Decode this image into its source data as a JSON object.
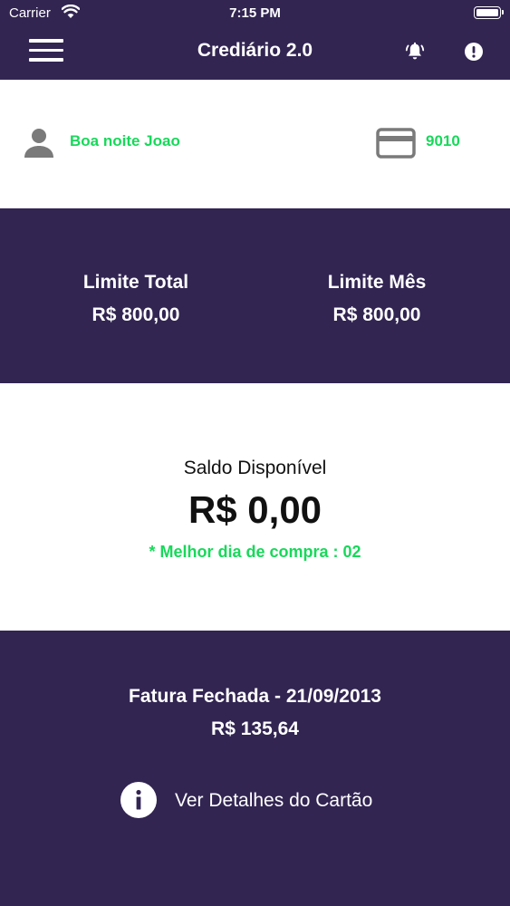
{
  "status_bar": {
    "carrier": "Carrier",
    "time": "7:15 PM"
  },
  "header": {
    "title": "Crediário 2.0"
  },
  "user": {
    "greeting": "Boa noite Joao",
    "card_number": "9010"
  },
  "limits": {
    "total_label": "Limite Total",
    "total_value": "R$ 800,00",
    "month_label": "Limite Mês",
    "month_value": "R$ 800,00"
  },
  "balance": {
    "label": "Saldo Disponível",
    "value": "R$ 0,00",
    "best_day": "* Melhor dia de compra : 02"
  },
  "invoice": {
    "title": "Fatura Fechada - 21/09/2013",
    "value": "R$ 135,64",
    "details_label": "Ver Detalhes do Cartão"
  },
  "icons": {
    "menu": "menu-icon",
    "bell": "bell-icon",
    "alert": "alert-icon",
    "user": "user-icon",
    "card": "credit-card-icon",
    "info": "info-icon"
  },
  "colors": {
    "primary": "#322552",
    "accent": "#18d85a",
    "text_dark": "#111111",
    "icon_gray": "#7a7a7a"
  }
}
